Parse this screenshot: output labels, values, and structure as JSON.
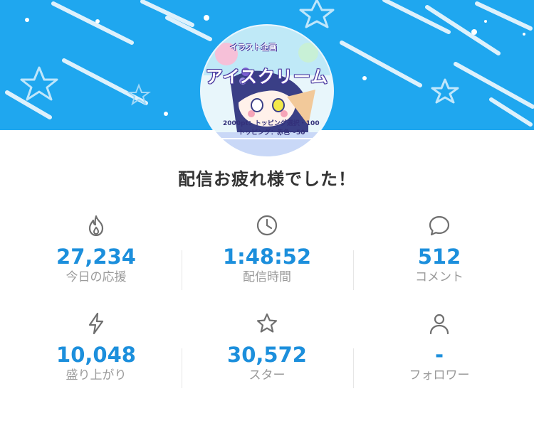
{
  "avatar": {
    "top_text": "イラスト企画",
    "title": "アイスクリーム",
    "line1": "2000pt：トッピング選択・100",
    "line2": "トッピング：赤色～50"
  },
  "heading": "配信お疲れ様でした！",
  "stats": [
    {
      "icon": "flame-icon",
      "value": "27,234",
      "label": "今日の応援"
    },
    {
      "icon": "clock-icon",
      "value": "1:48:52",
      "label": "配信時間"
    },
    {
      "icon": "speech-bubble-icon",
      "value": "512",
      "label": "コメント"
    },
    {
      "icon": "lightning-icon",
      "value": "10,048",
      "label": "盛り上がり"
    },
    {
      "icon": "star-icon",
      "value": "30,572",
      "label": "スター"
    },
    {
      "icon": "person-icon",
      "value": "-",
      "label": "フォロワー"
    }
  ],
  "colors": {
    "banner": "#1fa7ef",
    "value": "#1c8fdc",
    "label": "#9a9a9a",
    "heading": "#333333"
  }
}
